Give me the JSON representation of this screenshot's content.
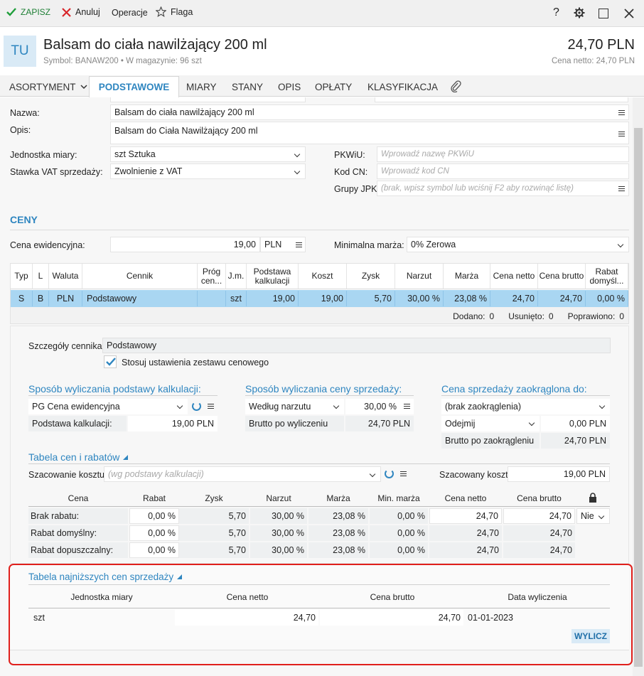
{
  "toolbar": {
    "save": "ZAPISZ",
    "cancel": "Anuluj",
    "ops": "Operacje",
    "flag": "Flaga",
    "help": "?"
  },
  "header": {
    "badge": "TU",
    "title": "Balsam do ciała nawilżający 200 ml",
    "symbol_line": "Symbol: BANAW200 • W magazynie: 96 szt",
    "price": "24,70 PLN",
    "net_line": "Cena netto: 24,70 PLN"
  },
  "tabs": [
    "ASORTYMENT",
    "PODSTAWOWE",
    "MIARY",
    "STANY",
    "OPIS",
    "OPŁATY",
    "KLASYFIKACJA"
  ],
  "form": {
    "nazwa_l": "Nazwa:",
    "nazwa": "Balsam do ciała nawilżający 200 ml",
    "opis_l": "Opis:",
    "opis": "Balsam do Ciała Nawilżający 200 ml",
    "jm_l": "Jednostka miary:",
    "jm": "szt  Sztuka",
    "vat_l": "Stawka VAT sprzedaży:",
    "vat": "Zwolnienie z VAT",
    "pkwiu_l": "PKWiU:",
    "pkwiu_ph": "Wprowadź nazwę PKWiU",
    "kodcn_l": "Kod CN:",
    "kodcn_ph": "Wprowadź kod CN",
    "jpk_l": "Grupy JPK:",
    "jpk_ph": "(brak, wpisz symbol lub wciśnij F2 aby rozwinąć listę)"
  },
  "ceny": {
    "title": "CENY",
    "cena_ew_l": "Cena ewidencyjna:",
    "cena_ew": "19,00",
    "currency": "PLN",
    "marza_l": "Minimalna marża:",
    "marza": "0%  Zerowa",
    "headers": [
      "Typ",
      "L",
      "Waluta",
      "Cennik",
      "Próg cen...",
      "J.m.",
      "Podstawa kalkulacji",
      "Koszt",
      "Zysk",
      "Narzut",
      "Marża",
      "Cena netto",
      "Cena brutto",
      "Rabat domyśl..."
    ],
    "row": [
      "S",
      "B",
      "PLN",
      "Podstawowy",
      "",
      "szt",
      "19,00",
      "19,00",
      "5,70",
      "30,00 %",
      "23,08 %",
      "24,70",
      "24,70",
      "0,00 %"
    ],
    "stats": {
      "dodano_l": "Dodano:",
      "dodano": "0",
      "usuniete_l": "Usunięto:",
      "usuniete": "0",
      "poprawiono_l": "Poprawiono:",
      "poprawiono": "0"
    }
  },
  "details": {
    "cennik_l": "Szczegóły cennika:",
    "cennik": "Podstawowy",
    "stosuj": "Stosuj ustawienia zestawu cenowego",
    "sp1": "Sposób wyliczania podstawy kalkulacji:",
    "sp1_val": "PG  Cena ewidencyjna",
    "podst_l": "Podstawa kalkulacji:",
    "podst": "19,00 PLN",
    "sp2": "Sposób wyliczania ceny sprzedaży:",
    "sp2_val": "Według narzutu",
    "sp2_pct": "30,00 %",
    "brutto_l": "Brutto po wyliczeniu",
    "brutto": "24,70 PLN",
    "sp3": "Cena sprzedaży zaokrąglona do:",
    "sp3_val": "(brak zaokrąglenia)",
    "odejmij": "Odejmij",
    "odejmij_val": "0,00 PLN",
    "zaokr_l": "Brutto po zaokrągleniu",
    "zaokr": "24,70 PLN"
  },
  "rabaty": {
    "title": "Tabela cen i rabatów",
    "szac_l": "Szacowanie kosztu:",
    "szac_ph": "(wg podstawy kalkulacji)",
    "szac_koszt_l": "Szacowany koszt:",
    "szac_koszt": "19,00 PLN",
    "headers": [
      "Cena",
      "Rabat",
      "Zysk",
      "Narzut",
      "Marża",
      "Min. marża",
      "Cena netto",
      "Cena brutto"
    ],
    "rows": [
      {
        "name": "Brak rabatu:",
        "vals": [
          "0,00 %",
          "5,70",
          "30,00 %",
          "23,08 %",
          "0,00 %",
          "24,70",
          "24,70"
        ],
        "nie": "Nie"
      },
      {
        "name": "Rabat domyślny:",
        "vals": [
          "0,00 %",
          "5,70",
          "30,00 %",
          "23,08 %",
          "0,00 %",
          "24,70",
          "24,70"
        ]
      },
      {
        "name": "Rabat dopuszczalny:",
        "vals": [
          "0,00 %",
          "5,70",
          "30,00 %",
          "23,08 %",
          "0,00 %",
          "24,70",
          "24,70"
        ]
      }
    ]
  },
  "najnizsze": {
    "title": "Tabela najniższych cen sprzedaży",
    "headers": [
      "Jednostka miary",
      "Cena netto",
      "Cena brutto",
      "Data wyliczenia"
    ],
    "row": [
      "szt",
      "24,70",
      "24,70",
      "01-01-2023"
    ],
    "button": "WYLICZ"
  },
  "colors": {
    "accent": "#2f86c0",
    "selected_row": "#a9d6f2",
    "highlight": "#e0201c"
  }
}
